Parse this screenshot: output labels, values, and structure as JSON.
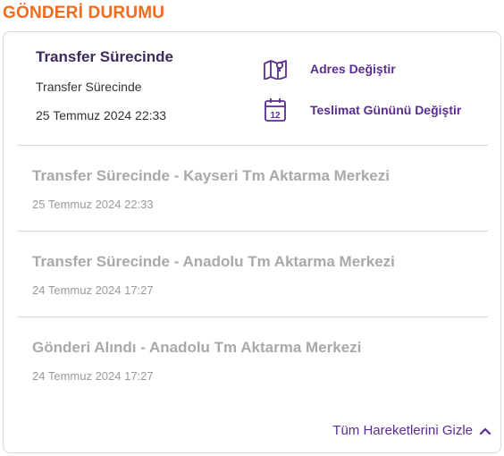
{
  "section_title": "GÖNDERİ DURUMU",
  "current_status": {
    "title": "Transfer Sürecinde",
    "subtitle": "Transfer Sürecinde",
    "date": "25 Temmuz 2024 22:33"
  },
  "actions": {
    "change_address": {
      "label": "Adres Değiştir",
      "icon": "map-pin-icon"
    },
    "change_delivery_day": {
      "label": "Teslimat Gününü Değiştir",
      "icon": "calendar-icon",
      "icon_number": "12"
    }
  },
  "events": [
    {
      "title": "Transfer Sürecinde - Kayseri Tm Aktarma Merkezi",
      "date": "25 Temmuz 2024 22:33"
    },
    {
      "title": "Transfer Sürecinde - Anadolu Tm Aktarma Merkezi",
      "date": "24 Temmuz 2024 17:27"
    },
    {
      "title": "Gönderi Alındı - Anadolu Tm Aktarma Merkezi",
      "date": "24 Temmuz 2024 17:27"
    }
  ],
  "toggle": {
    "label": "Tüm Hareketlerini Gizle",
    "icon": "chevron-up-icon"
  },
  "colors": {
    "accent_orange": "#f26a1b",
    "brand_purple": "#5a2d91",
    "muted_gray": "#a9a9a9"
  }
}
